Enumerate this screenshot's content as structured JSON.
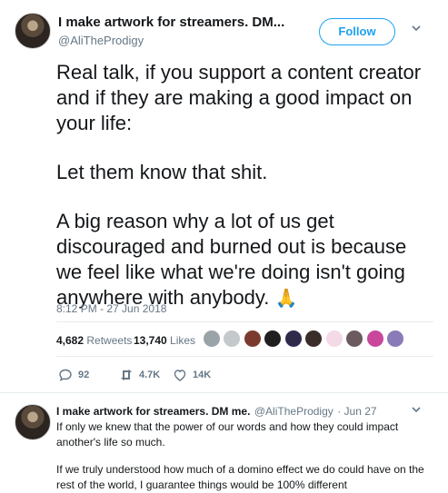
{
  "tweet": {
    "author_name": "I make artwork for streamers. DM...",
    "author_handle": "@AliTheProdigy",
    "follow_label": "Follow",
    "paragraphs": [
      "Real talk, if you support a content creator and if they are making a good impact on your life:",
      "Let them know that shit.",
      "A big reason why a lot of us get discouraged and burned out is because we feel like what we're doing isn't going anywhere with anybody."
    ],
    "emoji": "🙏",
    "timestamp": "8:12 PM - 27 Jun 2018",
    "retweets_count": "4,682",
    "retweets_label": "Retweets",
    "likes_count": "13,740",
    "likes_label": "Likes",
    "reply_count": "92",
    "retweet_action_count": "4.7K",
    "like_action_count": "14K"
  },
  "reply": {
    "author_name": "I make artwork for streamers. DM me.",
    "author_handle": "@AliTheProdigy",
    "date": "· Jun 27",
    "paragraphs": [
      "If only we knew that the power of our words and how they could impact another's life so much.",
      "If we truly understood how much of a domino effect we do could have on the rest of the world, I guarantee things would be 100% different"
    ]
  },
  "colors": {
    "accent": "#1da1f2",
    "muted": "#657786",
    "text": "#14171a"
  },
  "icons": [
    "chevron-down-icon",
    "reply-icon",
    "retweet-icon",
    "heart-icon",
    "praying-hands-emoji"
  ]
}
